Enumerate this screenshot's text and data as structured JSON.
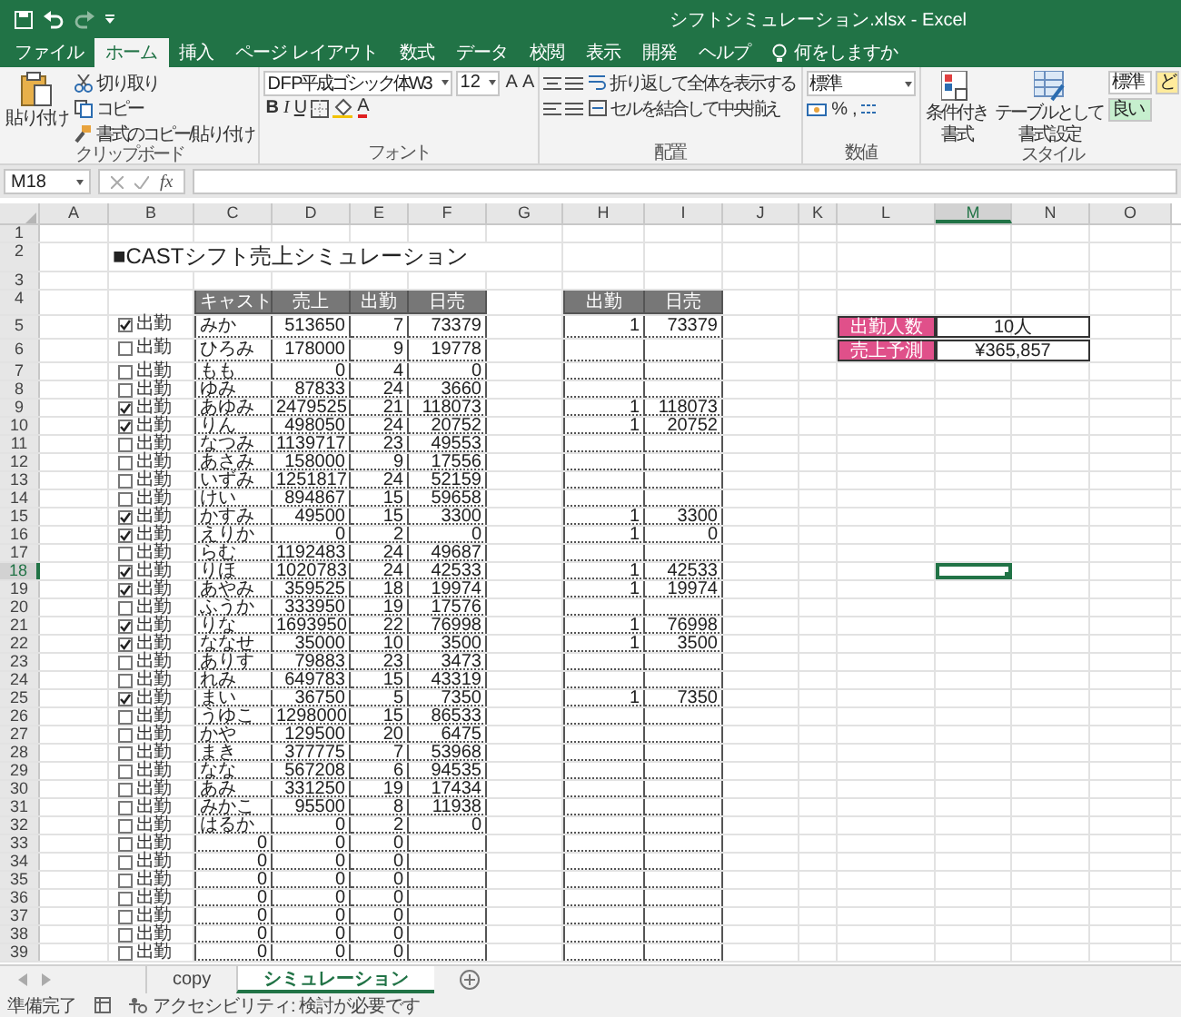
{
  "title_bar": {
    "title": "シフトシミュレーション.xlsx  -  Excel"
  },
  "ribbon_tabs": [
    {
      "label": "ファイル",
      "selected": false
    },
    {
      "label": "ホーム",
      "selected": true
    },
    {
      "label": "挿入",
      "selected": false
    },
    {
      "label": "ページ レイアウト",
      "selected": false
    },
    {
      "label": "数式",
      "selected": false
    },
    {
      "label": "データ",
      "selected": false
    },
    {
      "label": "校閲",
      "selected": false
    },
    {
      "label": "表示",
      "selected": false
    },
    {
      "label": "開発",
      "selected": false
    },
    {
      "label": "ヘルプ",
      "selected": false
    }
  ],
  "tell_me": "何をしますか",
  "ribbon_groups": [
    {
      "kind": "clipboard",
      "label": "クリップボード",
      "paste": "貼り付け",
      "items": [
        "切り取り",
        "コピー",
        "書式のコピー/貼り付け"
      ]
    },
    {
      "kind": "font",
      "label": "フォント",
      "font_name": "D F P平成ゴシック体W3",
      "font_size": "12",
      "size_buttons": [
        "A",
        "A"
      ],
      "style_buttons": [
        "B",
        "I",
        "U"
      ],
      "font_color": "A"
    },
    {
      "kind": "alignment",
      "label": "配置",
      "items": [
        "折り返して全体を表示する",
        "セルを結合して中央揃え"
      ]
    },
    {
      "kind": "number",
      "label": "数値",
      "format": "標準",
      "symbols": [
        "%",
        ","
      ]
    },
    {
      "kind": "styles",
      "label": "スタイル",
      "buttons": [
        [
          "条件付き",
          "書式"
        ],
        [
          "テーブルとして",
          "書式設定"
        ]
      ],
      "cell_styles": [
        {
          "label": "標準",
          "color": "#ffffff"
        },
        {
          "label": "良い",
          "color": "#c6efce"
        },
        {
          "label": "ど",
          "color": "#ffeb9c"
        }
      ]
    }
  ],
  "formula_bar": {
    "name_box": "M18",
    "function_button": "fx"
  },
  "sheet": {
    "columns": [
      {
        "label": "A",
        "selected": false
      },
      {
        "label": "B",
        "selected": false
      },
      {
        "label": "C",
        "selected": false
      },
      {
        "label": "D",
        "selected": false
      },
      {
        "label": "E",
        "selected": false
      },
      {
        "label": "F",
        "selected": false
      },
      {
        "label": "G",
        "selected": false
      },
      {
        "label": "H",
        "selected": false
      },
      {
        "label": "I",
        "selected": false
      },
      {
        "label": "J",
        "selected": false
      },
      {
        "label": "K",
        "selected": false
      },
      {
        "label": "L",
        "selected": false
      },
      {
        "label": "M",
        "selected": true
      },
      {
        "label": "N",
        "selected": false
      },
      {
        "label": "O",
        "selected": false
      }
    ],
    "rows": [
      {
        "label": "1",
        "selected": false
      },
      {
        "label": "2",
        "selected": false
      },
      {
        "label": "3",
        "selected": false
      },
      {
        "label": "4",
        "selected": false
      },
      {
        "label": "5",
        "selected": false
      },
      {
        "label": "6",
        "selected": false
      },
      {
        "label": "7",
        "selected": false
      },
      {
        "label": "8",
        "selected": false
      },
      {
        "label": "9",
        "selected": false
      },
      {
        "label": "10",
        "selected": false
      },
      {
        "label": "11",
        "selected": false
      },
      {
        "label": "12",
        "selected": false
      },
      {
        "label": "13",
        "selected": false
      },
      {
        "label": "14",
        "selected": false
      },
      {
        "label": "15",
        "selected": false
      },
      {
        "label": "16",
        "selected": false
      },
      {
        "label": "17",
        "selected": false
      },
      {
        "label": "18",
        "selected": true
      },
      {
        "label": "19",
        "selected": false
      },
      {
        "label": "20",
        "selected": false
      },
      {
        "label": "21",
        "selected": false
      },
      {
        "label": "22",
        "selected": false
      },
      {
        "label": "23",
        "selected": false
      },
      {
        "label": "24",
        "selected": false
      },
      {
        "label": "25",
        "selected": false
      },
      {
        "label": "26",
        "selected": false
      },
      {
        "label": "27",
        "selected": false
      },
      {
        "label": "28",
        "selected": false
      },
      {
        "label": "29",
        "selected": false
      },
      {
        "label": "30",
        "selected": false
      },
      {
        "label": "31",
        "selected": false
      },
      {
        "label": "32",
        "selected": false
      },
      {
        "label": "33",
        "selected": false
      },
      {
        "label": "34",
        "selected": false
      },
      {
        "label": "35",
        "selected": false
      },
      {
        "label": "36",
        "selected": false
      },
      {
        "label": "37",
        "selected": false
      },
      {
        "label": "38",
        "selected": false
      },
      {
        "label": "39",
        "selected": false
      }
    ],
    "title": "■CASTシフト売上シミュレーション",
    "table_columns": [
      "キャスト",
      "売上",
      "出勤",
      "日売"
    ],
    "simulation_columns": [
      "出勤",
      "日売"
    ],
    "table_rows": [
      {
        "attend": {
          "label": "出勤",
          "checked": true
        },
        "kind": "name",
        "cast": "みか",
        "sales": "513650",
        "days": "7",
        "daily": "73379",
        "simulation": [
          "1",
          "73379"
        ]
      },
      {
        "attend": {
          "label": "出勤",
          "checked": false
        },
        "kind": "name",
        "cast": "ひろみ",
        "sales": "178000",
        "days": "9",
        "daily": "19778"
      },
      {
        "attend": {
          "label": "出勤",
          "checked": false
        },
        "kind": "name",
        "cast": "もも",
        "sales": "0",
        "days": "4",
        "daily": "0"
      },
      {
        "attend": {
          "label": "出勤",
          "checked": false
        },
        "kind": "name",
        "cast": "ゆみ",
        "sales": "87833",
        "days": "24",
        "daily": "3660"
      },
      {
        "attend": {
          "label": "出勤",
          "checked": true
        },
        "kind": "name",
        "cast": "あゆみ",
        "sales": "2479525",
        "days": "21",
        "daily": "118073",
        "simulation": [
          "1",
          "118073"
        ]
      },
      {
        "attend": {
          "label": "出勤",
          "checked": true
        },
        "kind": "name",
        "cast": "りん",
        "sales": "498050",
        "days": "24",
        "daily": "20752",
        "simulation": [
          "1",
          "20752"
        ]
      },
      {
        "attend": {
          "label": "出勤",
          "checked": false
        },
        "kind": "name",
        "cast": "なつみ",
        "sales": "1139717",
        "days": "23",
        "daily": "49553"
      },
      {
        "attend": {
          "label": "出勤",
          "checked": false
        },
        "kind": "name",
        "cast": "あさみ",
        "sales": "158000",
        "days": "9",
        "daily": "17556"
      },
      {
        "attend": {
          "label": "出勤",
          "checked": false
        },
        "kind": "name",
        "cast": "いずみ",
        "sales": "1251817",
        "days": "24",
        "daily": "52159"
      },
      {
        "attend": {
          "label": "出勤",
          "checked": false
        },
        "kind": "name",
        "cast": "けい",
        "sales": "894867",
        "days": "15",
        "daily": "59658"
      },
      {
        "attend": {
          "label": "出勤",
          "checked": true
        },
        "kind": "name",
        "cast": "かすみ",
        "sales": "49500",
        "days": "15",
        "daily": "3300",
        "simulation": [
          "1",
          "3300"
        ]
      },
      {
        "attend": {
          "label": "出勤",
          "checked": true
        },
        "kind": "name",
        "cast": "えりか",
        "sales": "0",
        "days": "2",
        "daily": "0",
        "simulation": [
          "1",
          "0"
        ]
      },
      {
        "attend": {
          "label": "出勤",
          "checked": false
        },
        "kind": "name",
        "cast": "らむ",
        "sales": "1192483",
        "days": "24",
        "daily": "49687"
      },
      {
        "attend": {
          "label": "出勤",
          "checked": true
        },
        "kind": "name",
        "cast": "りほ",
        "sales": "1020783",
        "days": "24",
        "daily": "42533",
        "simulation": [
          "1",
          "42533"
        ]
      },
      {
        "attend": {
          "label": "出勤",
          "checked": true
        },
        "kind": "name",
        "cast": "あやみ",
        "sales": "359525",
        "days": "18",
        "daily": "19974",
        "simulation": [
          "1",
          "19974"
        ]
      },
      {
        "attend": {
          "label": "出勤",
          "checked": false
        },
        "kind": "name",
        "cast": "ふうか",
        "sales": "333950",
        "days": "19",
        "daily": "17576"
      },
      {
        "attend": {
          "label": "出勤",
          "checked": true
        },
        "kind": "name",
        "cast": "りな",
        "sales": "1693950",
        "days": "22",
        "daily": "76998",
        "simulation": [
          "1",
          "76998"
        ]
      },
      {
        "attend": {
          "label": "出勤",
          "checked": true
        },
        "kind": "name",
        "cast": "ななせ",
        "sales": "35000",
        "days": "10",
        "daily": "3500",
        "simulation": [
          "1",
          "3500"
        ]
      },
      {
        "attend": {
          "label": "出勤",
          "checked": false
        },
        "kind": "name",
        "cast": "ありす",
        "sales": "79883",
        "days": "23",
        "daily": "3473"
      },
      {
        "attend": {
          "label": "出勤",
          "checked": false
        },
        "kind": "name",
        "cast": "れみ",
        "sales": "649783",
        "days": "15",
        "daily": "43319"
      },
      {
        "attend": {
          "label": "出勤",
          "checked": true
        },
        "kind": "name",
        "cast": "まい",
        "sales": "36750",
        "days": "5",
        "daily": "7350",
        "simulation": [
          "1",
          "7350"
        ]
      },
      {
        "attend": {
          "label": "出勤",
          "checked": false
        },
        "kind": "name",
        "cast": "うゆこ",
        "sales": "1298000",
        "days": "15",
        "daily": "86533"
      },
      {
        "attend": {
          "label": "出勤",
          "checked": false
        },
        "kind": "name",
        "cast": "かや",
        "sales": "129500",
        "days": "20",
        "daily": "6475"
      },
      {
        "attend": {
          "label": "出勤",
          "checked": false
        },
        "kind": "name",
        "cast": "まき",
        "sales": "377775",
        "days": "7",
        "daily": "53968"
      },
      {
        "attend": {
          "label": "出勤",
          "checked": false
        },
        "kind": "name",
        "cast": "なな",
        "sales": "567208",
        "days": "6",
        "daily": "94535"
      },
      {
        "attend": {
          "label": "出勤",
          "checked": false
        },
        "kind": "name",
        "cast": "あみ",
        "sales": "331250",
        "days": "19",
        "daily": "17434"
      },
      {
        "attend": {
          "label": "出勤",
          "checked": false
        },
        "kind": "name",
        "cast": "みかこ",
        "sales": "95500",
        "days": "8",
        "daily": "11938"
      },
      {
        "attend": {
          "label": "出勤",
          "checked": false
        },
        "kind": "name",
        "cast": "はるか",
        "sales": "0",
        "days": "2",
        "daily": "0"
      },
      {
        "attend": {
          "label": "出勤",
          "checked": false
        },
        "kind": "blank",
        "cast": "0",
        "sales": "0",
        "days": "0"
      },
      {
        "attend": {
          "label": "出勤",
          "checked": false
        },
        "kind": "blank",
        "cast": "0",
        "sales": "0",
        "days": "0"
      },
      {
        "attend": {
          "label": "出勤",
          "checked": false
        },
        "kind": "blank",
        "cast": "0",
        "sales": "0",
        "days": "0"
      },
      {
        "attend": {
          "label": "出勤",
          "checked": false
        },
        "kind": "blank",
        "cast": "0",
        "sales": "0",
        "days": "0"
      },
      {
        "attend": {
          "label": "出勤",
          "checked": false
        },
        "kind": "blank",
        "cast": "0",
        "sales": "0",
        "days": "0"
      },
      {
        "attend": {
          "label": "出勤",
          "checked": false
        },
        "kind": "blank",
        "cast": "0",
        "sales": "0",
        "days": "0"
      },
      {
        "attend": {
          "label": "出勤",
          "checked": false
        },
        "kind": "blank",
        "cast": "0",
        "sales": "0",
        "days": "0"
      }
    ],
    "summary": [
      {
        "label": "出勤人数",
        "value": "10人"
      },
      {
        "label": "売上予測",
        "value": "¥365,857"
      }
    ]
  },
  "sheet_tabs": [
    {
      "label": "copy",
      "selected": false
    },
    {
      "label": "シミュレーション",
      "selected": true
    }
  ],
  "status_bar": {
    "status": "準備完了",
    "accessibility": "アクセシビリティ: 検討が必要です"
  }
}
